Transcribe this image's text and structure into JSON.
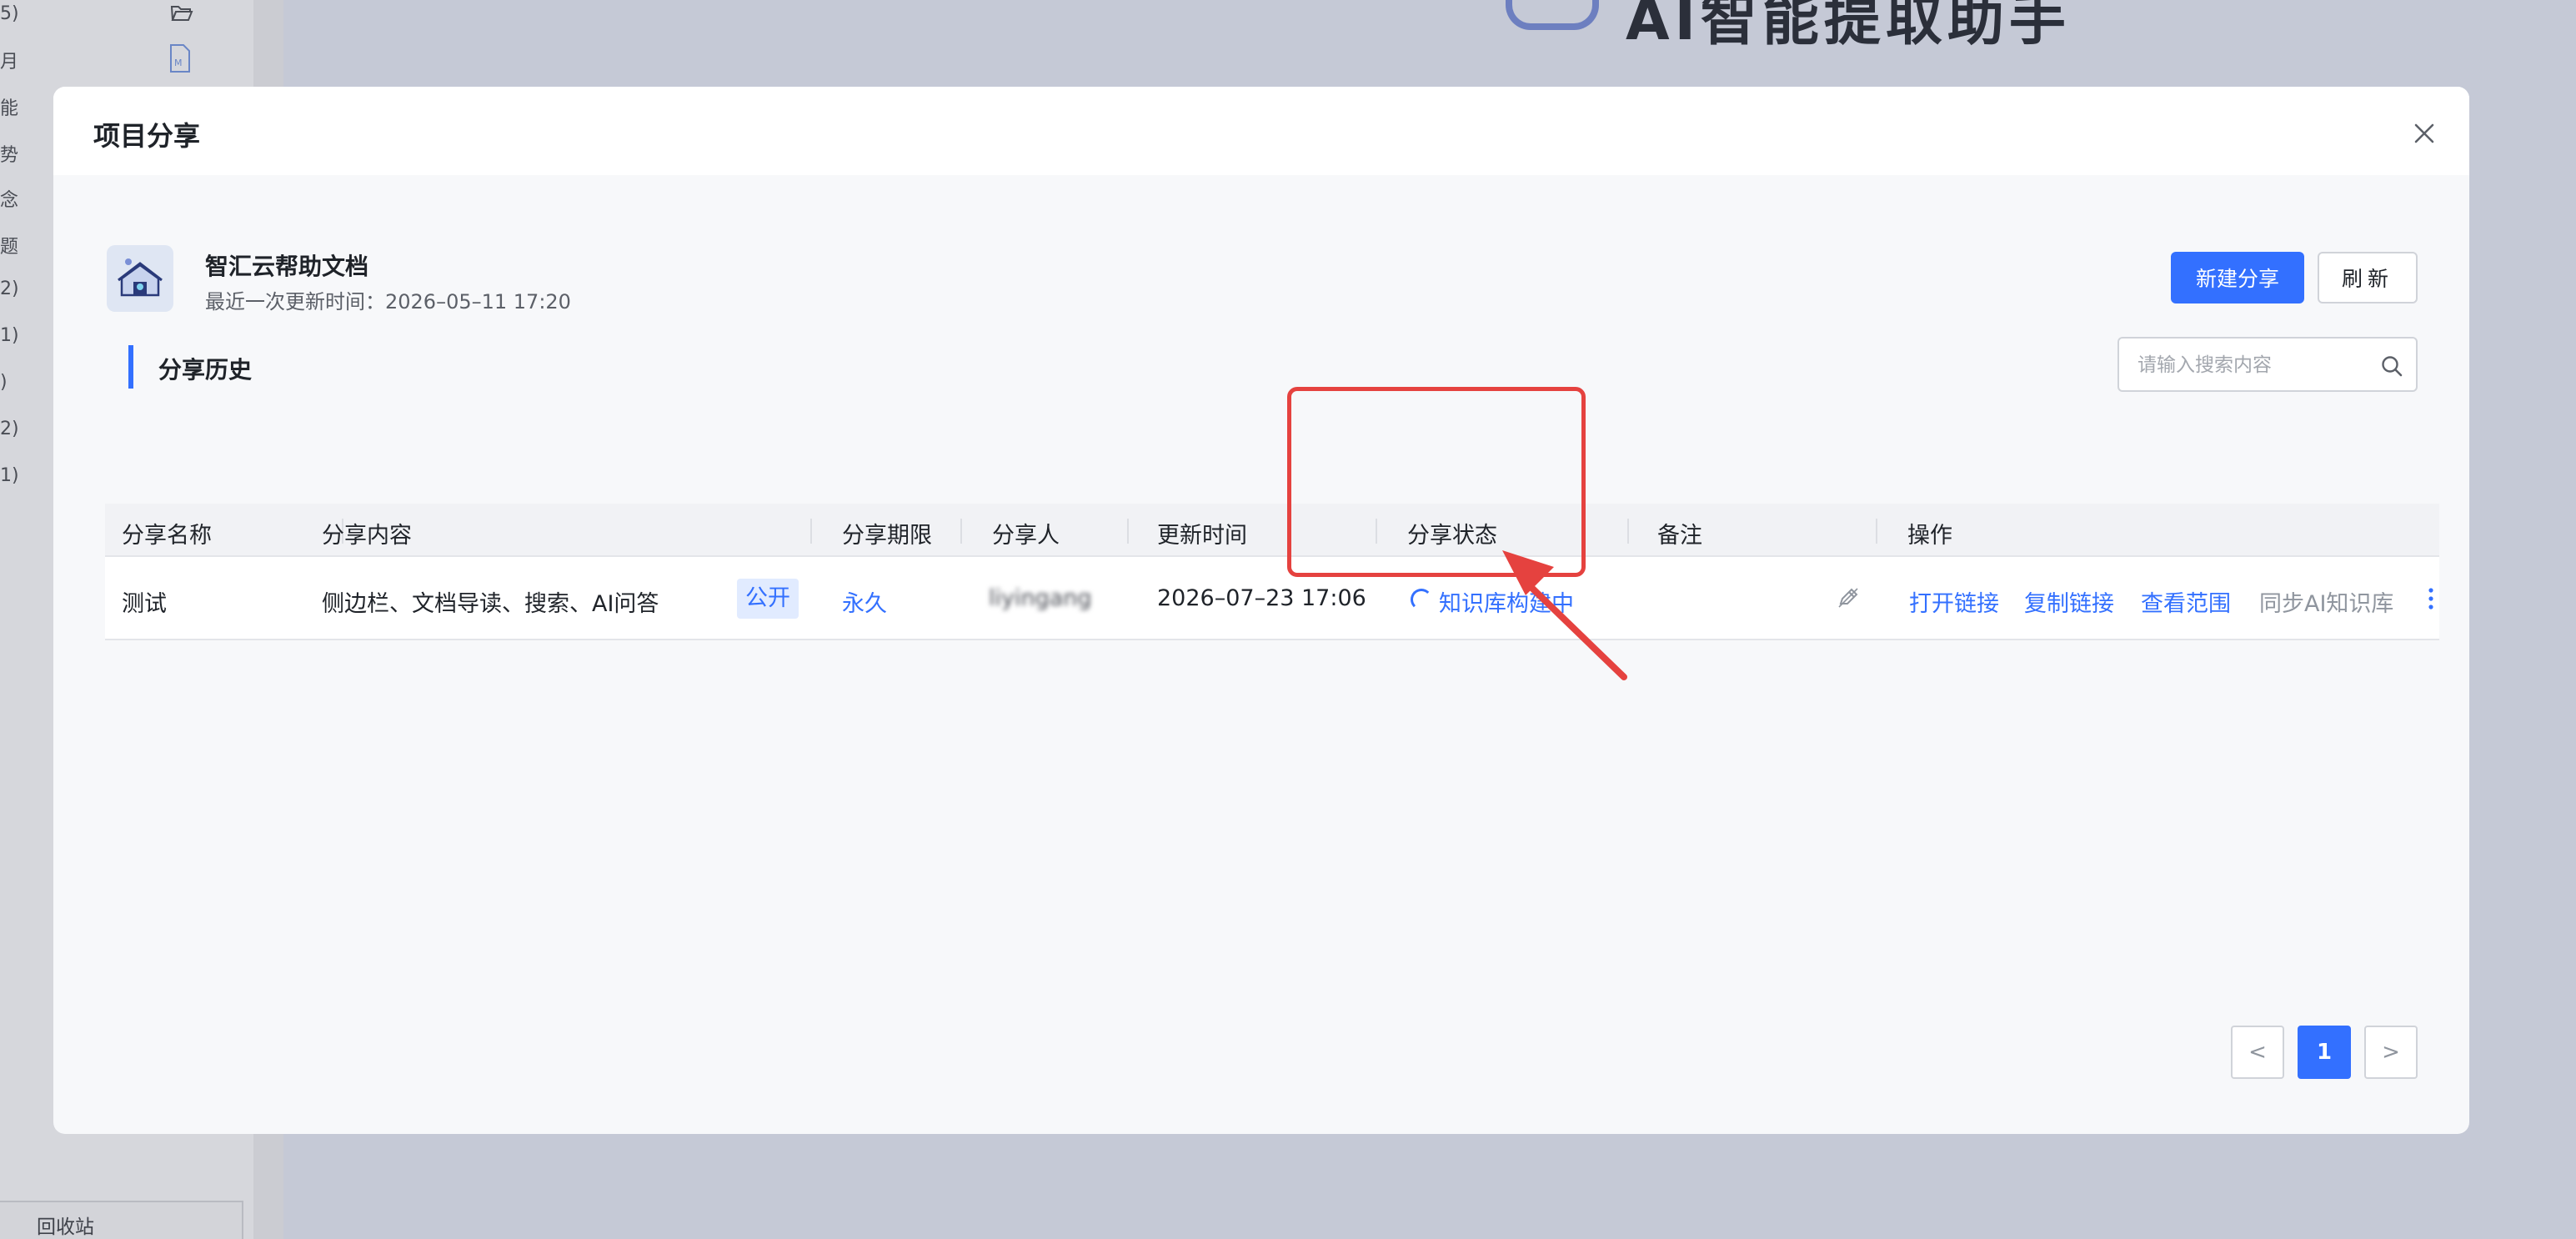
{
  "background": {
    "sidebar_fragments": [
      "5)",
      "月",
      "能",
      "势",
      "念",
      "题",
      "2)",
      "1)",
      ")",
      "2)",
      "1)"
    ],
    "recycle_bin": "回收站",
    "title_fragment": "AI智能提取助手"
  },
  "modal": {
    "title": "项目分享",
    "project": {
      "name": "智汇云帮助文档",
      "updated": "最近一次更新时间：2026–05–11 17:20"
    },
    "buttons": {
      "new_share": "新建分享",
      "refresh": "刷新"
    },
    "section_title": "分享历史",
    "search": {
      "placeholder": "请输入搜索内容"
    },
    "table": {
      "headers": [
        "分享名称",
        "分享内容",
        "分享期限",
        "分享人",
        "更新时间",
        "分享状态",
        "备注",
        "操作"
      ],
      "rows": [
        {
          "name": "测试",
          "content": "侧边栏、文档导读、搜索、AI问答",
          "visibility": "公开",
          "period": "永久",
          "sharer": "liyingang",
          "updated": "2026–07–23 17:06",
          "status": "知识库构建中",
          "remark": "",
          "actions": {
            "open_link": "打开链接",
            "copy_link": "复制链接",
            "view_scope": "查看范围",
            "sync_ai": "同步AI知识库"
          }
        }
      ]
    },
    "pagination": {
      "prev": "<",
      "current": "1",
      "next": ">"
    }
  },
  "colors": {
    "primary": "#3370ff",
    "annotation": "#e5423f"
  }
}
